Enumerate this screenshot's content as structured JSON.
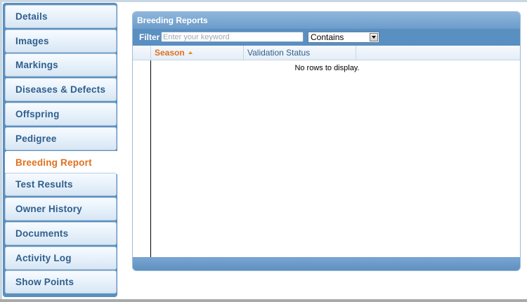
{
  "sidebar": {
    "tabs": [
      {
        "label": "Details"
      },
      {
        "label": "Images"
      },
      {
        "label": "Markings"
      },
      {
        "label": "Diseases & Defects"
      },
      {
        "label": "Offspring"
      },
      {
        "label": "Pedigree"
      },
      {
        "label": "Breeding Report"
      },
      {
        "label": "Test Results"
      },
      {
        "label": "Owner History"
      },
      {
        "label": "Documents"
      },
      {
        "label": "Activity Log"
      },
      {
        "label": "Show Points"
      }
    ],
    "active_index": 6
  },
  "panel": {
    "title": "Breeding Reports",
    "filter": {
      "label": "Filter",
      "placeholder": "Enter your keyword",
      "value": "",
      "operator": "Contains"
    },
    "grid": {
      "columns": [
        "Season",
        "Validation Status"
      ],
      "sort_column": "Season",
      "sort_direction": "ascending",
      "empty_message": "No rows to display."
    }
  },
  "colors": {
    "accent": "#e0701e",
    "sidebar_bg": "#5b8fbe",
    "header_bg": "#6c9cca"
  }
}
